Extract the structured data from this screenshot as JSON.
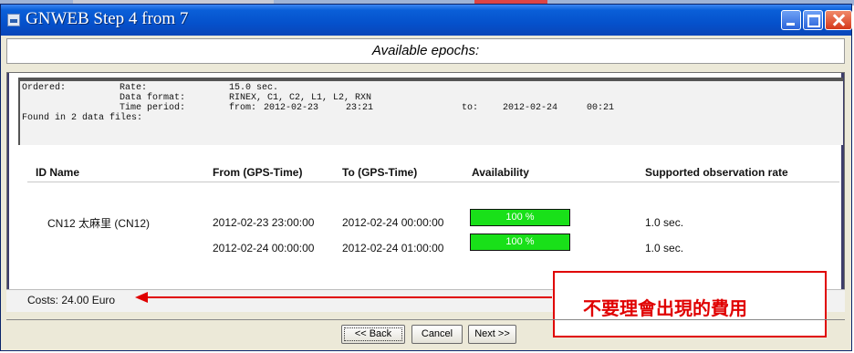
{
  "window": {
    "title": "GNWEB Step 4 from 7",
    "header": "Available epochs:"
  },
  "info": {
    "ordered_label": "Ordered:",
    "rate_label": "Rate:",
    "rate_value": "15.0 sec.",
    "format_label": "Data format:",
    "format_value": "RINEX, C1, C2, L1, L2, RXN",
    "period_label": "Time period:",
    "from_label": "from:",
    "from_date": "2012-02-23",
    "from_time": "23:21",
    "to_label": "to:",
    "to_date": "2012-02-24",
    "to_time": "00:21",
    "found": "Found in  2 data files:"
  },
  "table": {
    "columns": [
      "ID Name",
      "From (GPS-Time)",
      "To (GPS-Time)",
      "Availability",
      "Supported observation rate"
    ],
    "rows": [
      {
        "name": "CN12 太麻里 (CN12)",
        "from": "2012-02-23  23:00:00",
        "to": "2012-02-24  00:00:00",
        "availability": "100 %",
        "availability_fraction": 1.0,
        "rate": "1.0 sec."
      },
      {
        "name": "",
        "from": "2012-02-24  00:00:00",
        "to": "2012-02-24  01:00:00",
        "availability": "100 %",
        "availability_fraction": 1.0,
        "rate": "1.0 sec."
      }
    ]
  },
  "costs": "Costs: 24.00 Euro",
  "annotation": "不要理會出現的費用",
  "buttons": {
    "back": "<< Back",
    "cancel": "Cancel",
    "next": "Next >>"
  },
  "colors": {
    "titlebar": "#0551cc",
    "availability_bar": "#19e019",
    "annotation": "#e00000"
  }
}
